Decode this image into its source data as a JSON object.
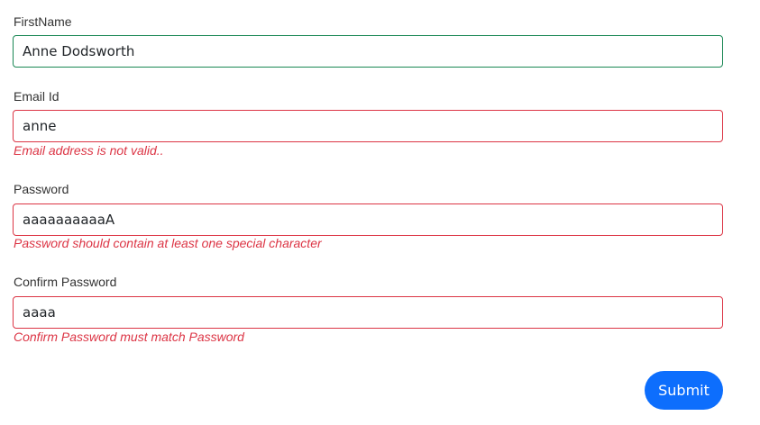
{
  "form": {
    "first_name": {
      "label": "FirstName",
      "value": "Anne Dodsworth",
      "state": "valid"
    },
    "email": {
      "label": "Email Id",
      "value": "anne",
      "error": "Email address is not valid..",
      "state": "invalid"
    },
    "password": {
      "label": "Password",
      "value": "aaaaaaaaaaA",
      "error": "Password should contain at least one special character",
      "state": "invalid"
    },
    "confirm_password": {
      "label": "Confirm Password",
      "value": "aaaa",
      "error": "Confirm Password must match Password",
      "state": "invalid"
    },
    "submit_label": "Submit"
  },
  "colors": {
    "valid_border": "#198754",
    "invalid_border": "#dc3545",
    "error_text": "#dc3545",
    "button_bg": "#0d6efd",
    "button_text": "#ffffff"
  }
}
